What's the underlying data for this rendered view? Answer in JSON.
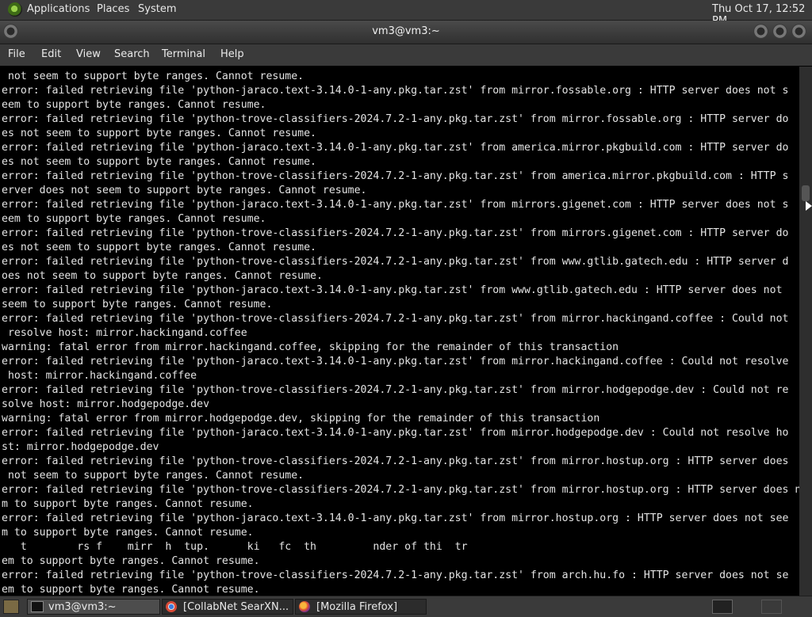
{
  "top_panel": {
    "menus": [
      "Applications",
      "Places",
      "System"
    ],
    "clock": "Thu Oct 17, 12:52 PM"
  },
  "window": {
    "title": "vm3@vm3:~",
    "menu": [
      "File",
      "Edit",
      "View",
      "Search",
      "Terminal",
      "Help"
    ]
  },
  "terminal": {
    "lines": [
      " not seem to support byte ranges. Cannot resume.",
      "error: failed retrieving file 'python-jaraco.text-3.14.0-1-any.pkg.tar.zst' from mirror.fossable.org : HTTP server does not s",
      "eem to support byte ranges. Cannot resume.",
      "error: failed retrieving file 'python-trove-classifiers-2024.7.2-1-any.pkg.tar.zst' from mirror.fossable.org : HTTP server do",
      "es not seem to support byte ranges. Cannot resume.",
      "error: failed retrieving file 'python-jaraco.text-3.14.0-1-any.pkg.tar.zst' from america.mirror.pkgbuild.com : HTTP server do",
      "es not seem to support byte ranges. Cannot resume.",
      "error: failed retrieving file 'python-trove-classifiers-2024.7.2-1-any.pkg.tar.zst' from america.mirror.pkgbuild.com : HTTP s",
      "erver does not seem to support byte ranges. Cannot resume.",
      "error: failed retrieving file 'python-jaraco.text-3.14.0-1-any.pkg.tar.zst' from mirrors.gigenet.com : HTTP server does not s",
      "eem to support byte ranges. Cannot resume.",
      "error: failed retrieving file 'python-trove-classifiers-2024.7.2-1-any.pkg.tar.zst' from mirrors.gigenet.com : HTTP server do",
      "es not seem to support byte ranges. Cannot resume.",
      "error: failed retrieving file 'python-trove-classifiers-2024.7.2-1-any.pkg.tar.zst' from www.gtlib.gatech.edu : HTTP server d",
      "oes not seem to support byte ranges. Cannot resume.",
      "error: failed retrieving file 'python-jaraco.text-3.14.0-1-any.pkg.tar.zst' from www.gtlib.gatech.edu : HTTP server does not ",
      "seem to support byte ranges. Cannot resume.",
      "error: failed retrieving file 'python-trove-classifiers-2024.7.2-1-any.pkg.tar.zst' from mirror.hackingand.coffee : Could not",
      " resolve host: mirror.hackingand.coffee",
      "warning: fatal error from mirror.hackingand.coffee, skipping for the remainder of this transaction",
      "error: failed retrieving file 'python-jaraco.text-3.14.0-1-any.pkg.tar.zst' from mirror.hackingand.coffee : Could not resolve",
      " host: mirror.hackingand.coffee",
      "error: failed retrieving file 'python-trove-classifiers-2024.7.2-1-any.pkg.tar.zst' from mirror.hodgepodge.dev : Could not re",
      "solve host: mirror.hodgepodge.dev",
      "warning: fatal error from mirror.hodgepodge.dev, skipping for the remainder of this transaction",
      "error: failed retrieving file 'python-jaraco.text-3.14.0-1-any.pkg.tar.zst' from mirror.hodgepodge.dev : Could not resolve ho",
      "st: mirror.hodgepodge.dev",
      "error: failed retrieving file 'python-trove-classifiers-2024.7.2-1-any.pkg.tar.zst' from mirror.hostup.org : HTTP server does",
      " not seem to support byte ranges. Cannot resume.",
      "error: failed retrieving file 'python-trove-classifiers-2024.7.2-1-any.pkg.tar.zst' from mirror.hostup.org : HTTP server does not see",
      "m to support byte ranges. Cannot resume.",
      "error: failed retrieving file 'python-jaraco.text-3.14.0-1-any.pkg.tar.zst' from mirror.hostup.org : HTTP server does not see",
      "m to support byte ranges. Cannot resume.",
      "   t        rs f    mirr  h  tup.      ki   fc  th         nder of thi  tr",
      "em to support byte ranges. Cannot resume.",
      "error: failed retrieving file 'python-trove-classifiers-2024.7.2-1-any.pkg.tar.zst' from arch.hu.fo : HTTP server does not se",
      "em to support byte ranges. Cannot resume."
    ]
  },
  "taskbar": {
    "tasks": [
      {
        "label": "vm3@vm3:~",
        "icon": "terminal-icon"
      },
      {
        "label": "[CollabNet SearXN...",
        "icon": "chromium-icon"
      },
      {
        "label": "[Mozilla Firefox]",
        "icon": "firefox-icon"
      }
    ]
  }
}
